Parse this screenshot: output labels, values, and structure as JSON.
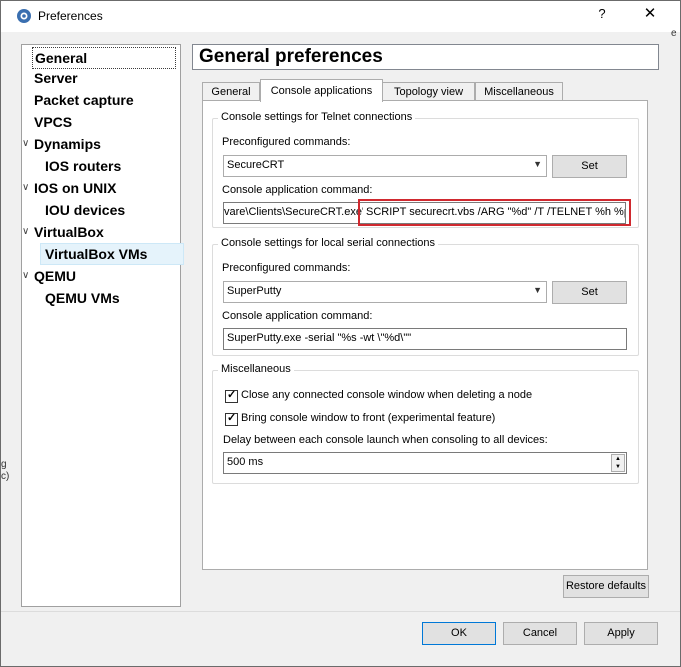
{
  "window": {
    "title": "Preferences",
    "help": "?",
    "close": "✕",
    "edge_clip_right": "e",
    "edge_clip_left": [
      "g",
      "c)"
    ]
  },
  "sidebar": {
    "items": [
      {
        "label": "General"
      },
      {
        "label": "Server"
      },
      {
        "label": "Packet capture"
      },
      {
        "label": "VPCS"
      },
      {
        "label": "Dynamips"
      },
      {
        "label": "IOS routers"
      },
      {
        "label": "IOS on UNIX"
      },
      {
        "label": "IOU devices"
      },
      {
        "label": "VirtualBox"
      },
      {
        "label": "VirtualBox VMs"
      },
      {
        "label": "QEMU"
      },
      {
        "label": "QEMU VMs"
      }
    ],
    "expand_glyph": "∨"
  },
  "header": {
    "title": "General preferences"
  },
  "tabs": [
    {
      "label": "General"
    },
    {
      "label": "Console applications"
    },
    {
      "label": "Topology view"
    },
    {
      "label": "Miscellaneous"
    }
  ],
  "telnet": {
    "group_title": "Console settings for Telnet connections",
    "preconfigured_label": "Preconfigured commands:",
    "preconfigured_value": "SecureCRT",
    "set_label": "Set",
    "command_label": "Console application command:",
    "command_value_left": "vare\\Clients\\SecureCRT.exe\"",
    "command_value_right": "SCRIPT securecrt.vbs /ARG \"%d\" /T /TELNET %h %p"
  },
  "serial": {
    "group_title": "Console settings for local serial connections",
    "preconfigured_label": "Preconfigured commands:",
    "preconfigured_value": "SuperPutty",
    "set_label": "Set",
    "command_label": "Console application command:",
    "command_value": "SuperPutty.exe -serial \"%s -wt \\\"%d\\\"\""
  },
  "misc": {
    "group_title": "Miscellaneous",
    "close_console_label": "Close any connected console window when deleting a node",
    "close_console_checked": true,
    "bring_front_label": "Bring console window to front (experimental feature)",
    "bring_front_checked": true,
    "delay_label": "Delay between each console launch when consoling to all devices:",
    "delay_value": "500 ms"
  },
  "footer": {
    "restore_label": "Restore defaults",
    "ok_label": "OK",
    "cancel_label": "Cancel",
    "apply_label": "Apply"
  },
  "icons": {
    "check": "✓",
    "combo_arrow": "▼",
    "spin_up": "▲",
    "spin_down": "▼"
  }
}
